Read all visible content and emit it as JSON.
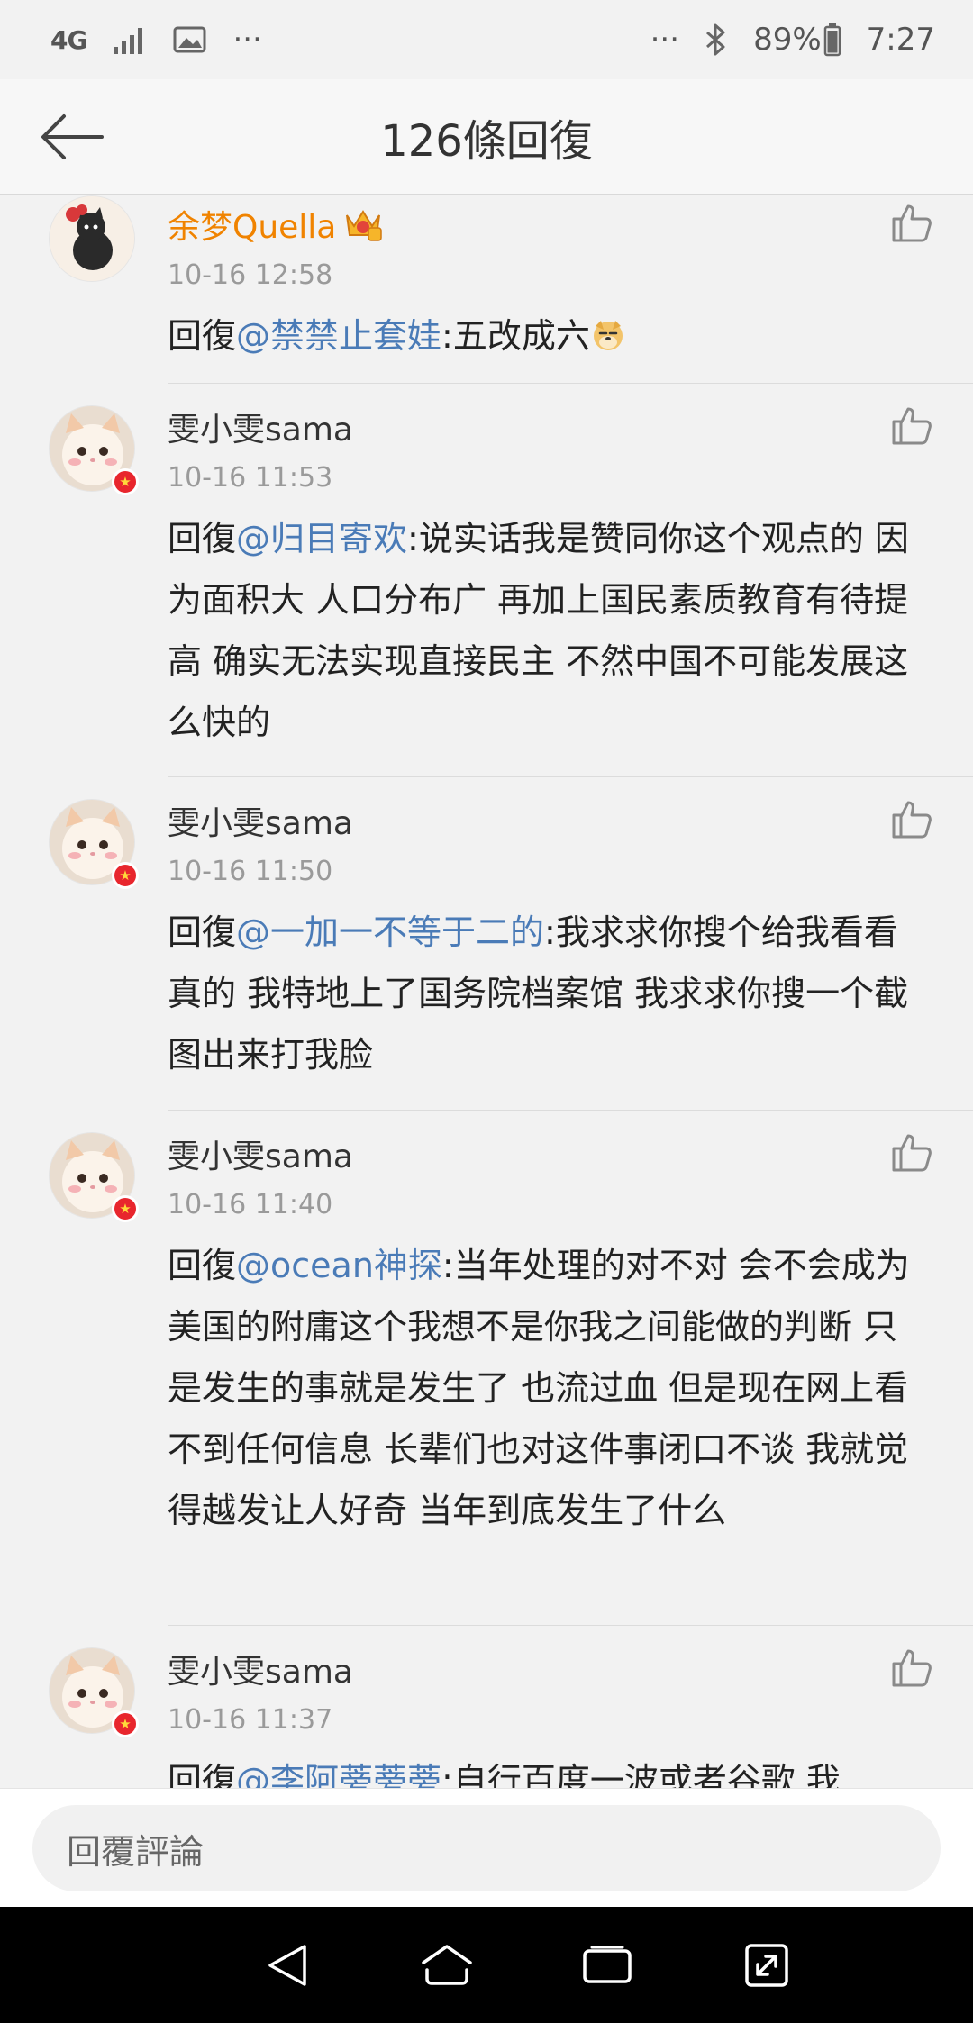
{
  "status_bar": {
    "network": "4G",
    "ellipsis_left": "···",
    "ellipsis_right": "···",
    "battery": "89%",
    "time": "7:27"
  },
  "header": {
    "title": "126條回復"
  },
  "comments": [
    {
      "username": "余梦Quella",
      "vip": true,
      "time": "10-16 12:58",
      "reply_prefix": "回復",
      "mention": "@禁禁止套娃",
      "text": ":五改成六",
      "emoji": "doge"
    },
    {
      "username": "雯小雯sama",
      "time": "10-16 11:53",
      "reply_prefix": "回復",
      "mention": "@归目寄欢",
      "text": ":说实话我是赞同你这个观点的 因为面积大 人口分布广 再加上国民素质教育有待提高 确实无法实现直接民主 不然中国不可能发展这么快的"
    },
    {
      "username": "雯小雯sama",
      "time": "10-16 11:50",
      "reply_prefix": "回復",
      "mention": "@一加一不等于二的",
      "text": ":我求求你搜个给我看看 真的 我特地上了国务院档案馆 我求求你搜一个截图出来打我脸"
    },
    {
      "username": "雯小雯sama",
      "time": "10-16 11:40",
      "reply_prefix": "回復",
      "mention": "@ocean神探",
      "text": ":当年处理的对不对 会不会成为美国的附庸这个我想不是你我之间能做的判断 只是发生的事就是发生了 也流过血 但是现在网上看不到任何信息 长辈们也对这件事闭口不谈 我就觉得越发让人好奇 当年到底发生了什么"
    },
    {
      "username": "雯小雯sama",
      "time": "10-16 11:37",
      "reply_prefix": "回復",
      "mention": "@李阿蒡蒡蒡",
      "text": ":自行百度一波或者谷歌 我"
    }
  ],
  "reply_box": {
    "placeholder": "回覆評論"
  },
  "colors": {
    "mention": "#4a7bb7",
    "vip_name": "#f08300",
    "badge": "#e8262d"
  }
}
